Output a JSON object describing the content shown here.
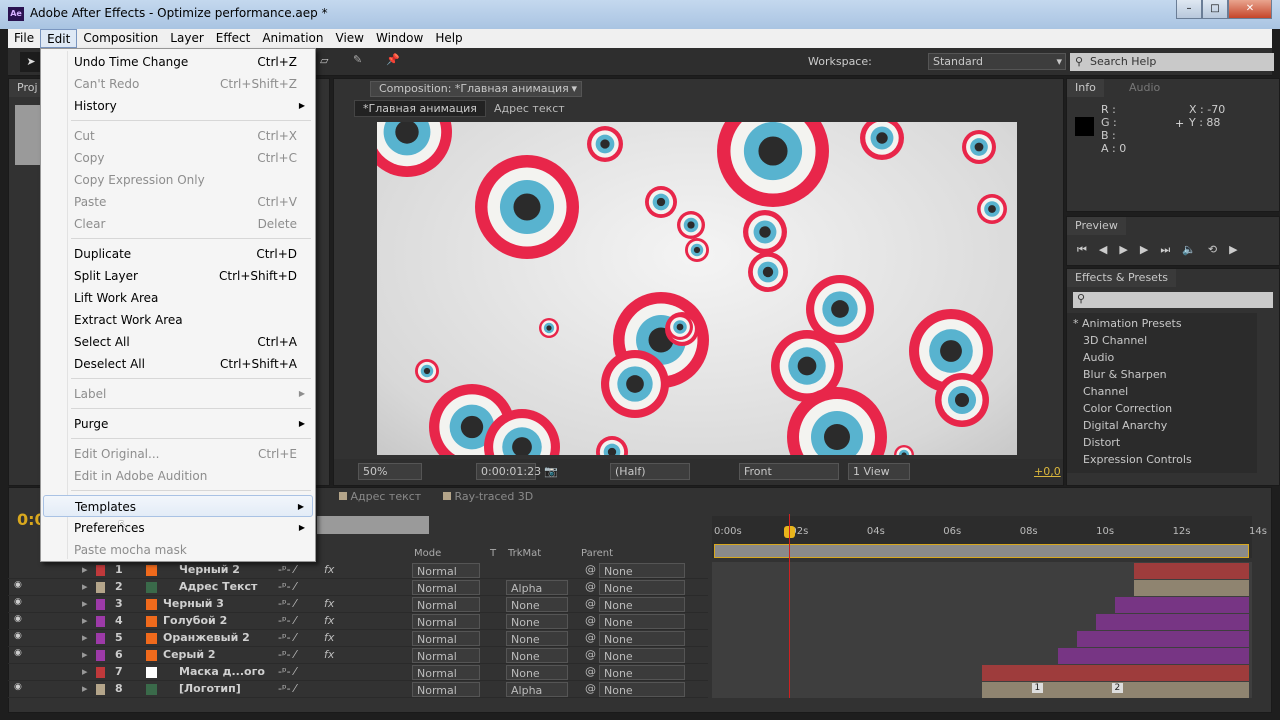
{
  "window": {
    "title": "Adobe After Effects - Optimize performance.aep *",
    "app_icon": "Ae"
  },
  "menubar": [
    "File",
    "Edit",
    "Composition",
    "Layer",
    "Effect",
    "Animation",
    "View",
    "Window",
    "Help"
  ],
  "toolbar": {
    "workspace_label": "Workspace:",
    "workspace_value": "Standard",
    "search_placeholder": "Search Help"
  },
  "edit_menu": [
    {
      "label": "Undo Time Change",
      "shortcut": "Ctrl+Z"
    },
    {
      "label": "Can't Redo",
      "shortcut": "Ctrl+Shift+Z",
      "disabled": true
    },
    {
      "label": "History",
      "submenu": true
    },
    {
      "sep": true
    },
    {
      "label": "Cut",
      "shortcut": "Ctrl+X",
      "disabled": true
    },
    {
      "label": "Copy",
      "shortcut": "Ctrl+C",
      "disabled": true
    },
    {
      "label": "Copy Expression Only",
      "disabled": true
    },
    {
      "label": "Paste",
      "shortcut": "Ctrl+V",
      "disabled": true
    },
    {
      "label": "Clear",
      "shortcut": "Delete",
      "disabled": true
    },
    {
      "sep": true
    },
    {
      "label": "Duplicate",
      "shortcut": "Ctrl+D"
    },
    {
      "label": "Split Layer",
      "shortcut": "Ctrl+Shift+D"
    },
    {
      "label": "Lift Work Area"
    },
    {
      "label": "Extract Work Area"
    },
    {
      "label": "Select All",
      "shortcut": "Ctrl+A"
    },
    {
      "label": "Deselect All",
      "shortcut": "Ctrl+Shift+A"
    },
    {
      "sep": true
    },
    {
      "label": "Label",
      "submenu": true,
      "disabled": true
    },
    {
      "sep": true
    },
    {
      "label": "Purge",
      "submenu": true
    },
    {
      "sep": true
    },
    {
      "label": "Edit Original...",
      "shortcut": "Ctrl+E",
      "disabled": true
    },
    {
      "label": "Edit in Adobe Audition",
      "disabled": true
    },
    {
      "sep": true
    },
    {
      "label": "Templates",
      "submenu": true,
      "highlighted": true
    },
    {
      "label": "Preferences",
      "submenu": true
    },
    {
      "label": "Paste mocha mask",
      "disabled": true
    }
  ],
  "project": {
    "tab": "Proj"
  },
  "composition": {
    "tab": "Composition: *Главная анимация",
    "breadcrumbs": [
      "*Главная анимация",
      "Адрес текст"
    ],
    "zoom": "50%",
    "timecode": "0:00:01:23",
    "resolution": "(Half)",
    "view": "Front",
    "views": "1 View",
    "exposure": "+0,0"
  },
  "info": {
    "tabs": [
      "Info",
      "Audio"
    ],
    "r": "R :",
    "g": "G :",
    "b": "B :",
    "a": "A : 0",
    "x": "X : -70",
    "y": "Y : 88",
    "swatch_color": "#000000"
  },
  "preview": {
    "tab": "Preview"
  },
  "effects": {
    "tab": "Effects & Presets",
    "items": [
      "* Animation Presets",
      "3D Channel",
      "Audio",
      "Blur & Sharpen",
      "Channel",
      "Color Correction",
      "Digital Anarchy",
      "Distort",
      "Expression Controls"
    ]
  },
  "timeline": {
    "tabs": [
      "Адрес текст",
      "Ray-traced 3D"
    ],
    "time": "0:0",
    "columns": {
      "mode": "Mode",
      "t": "T",
      "trkmat": "TrkMat",
      "parent": "Parent"
    },
    "ruler": [
      "0:00s",
      "02s",
      "04s",
      "06s",
      "08s",
      "10s",
      "12s",
      "14s"
    ],
    "current_time_s": 1.96,
    "duration_s": 14,
    "layers": [
      {
        "num": "1",
        "name": "Черный 2",
        "label_color": "#c0393b",
        "mode": "Normal",
        "trkmat": "",
        "parent": "None",
        "fx": true,
        "in_s": 11.0,
        "bar_color": "#9e3c3c"
      },
      {
        "num": "2",
        "name": "Адрес Текст",
        "label_color": "#b4a58a",
        "mode": "Normal",
        "trkmat": "Alpha",
        "parent": "None",
        "fx": false,
        "in_s": 11.0,
        "bar_color": "#8f8470"
      },
      {
        "num": "3",
        "name": "Черный 3",
        "label_color": "#9d3aa8",
        "mode": "Normal",
        "trkmat": "None",
        "parent": "None",
        "fx": true,
        "in_s": 10.5,
        "bar_color": "#773584"
      },
      {
        "num": "4",
        "name": "Голубой 2",
        "label_color": "#9d3aa8",
        "mode": "Normal",
        "trkmat": "None",
        "parent": "None",
        "fx": true,
        "in_s": 10.0,
        "bar_color": "#773584"
      },
      {
        "num": "5",
        "name": "Оранжевый 2",
        "label_color": "#9d3aa8",
        "mode": "Normal",
        "trkmat": "None",
        "parent": "None",
        "fx": true,
        "in_s": 9.5,
        "bar_color": "#773584"
      },
      {
        "num": "6",
        "name": "Серый 2",
        "label_color": "#9d3aa8",
        "mode": "Normal",
        "trkmat": "None",
        "parent": "None",
        "fx": true,
        "in_s": 9.0,
        "bar_color": "#773584"
      },
      {
        "num": "7",
        "name": "Маска д...ого",
        "label_color": "#c0393b",
        "mode": "Normal",
        "trkmat": "None",
        "parent": "None",
        "fx": false,
        "in_s": 7.0,
        "bar_color": "#9e3c3c"
      },
      {
        "num": "8",
        "name": "[Логотип]",
        "label_color": "#b4a58a",
        "mode": "Normal",
        "trkmat": "Alpha",
        "parent": "None",
        "fx": false,
        "in_s": 7.0,
        "bar_color": "#8f8470",
        "markers": [
          "1",
          "2"
        ]
      }
    ]
  }
}
